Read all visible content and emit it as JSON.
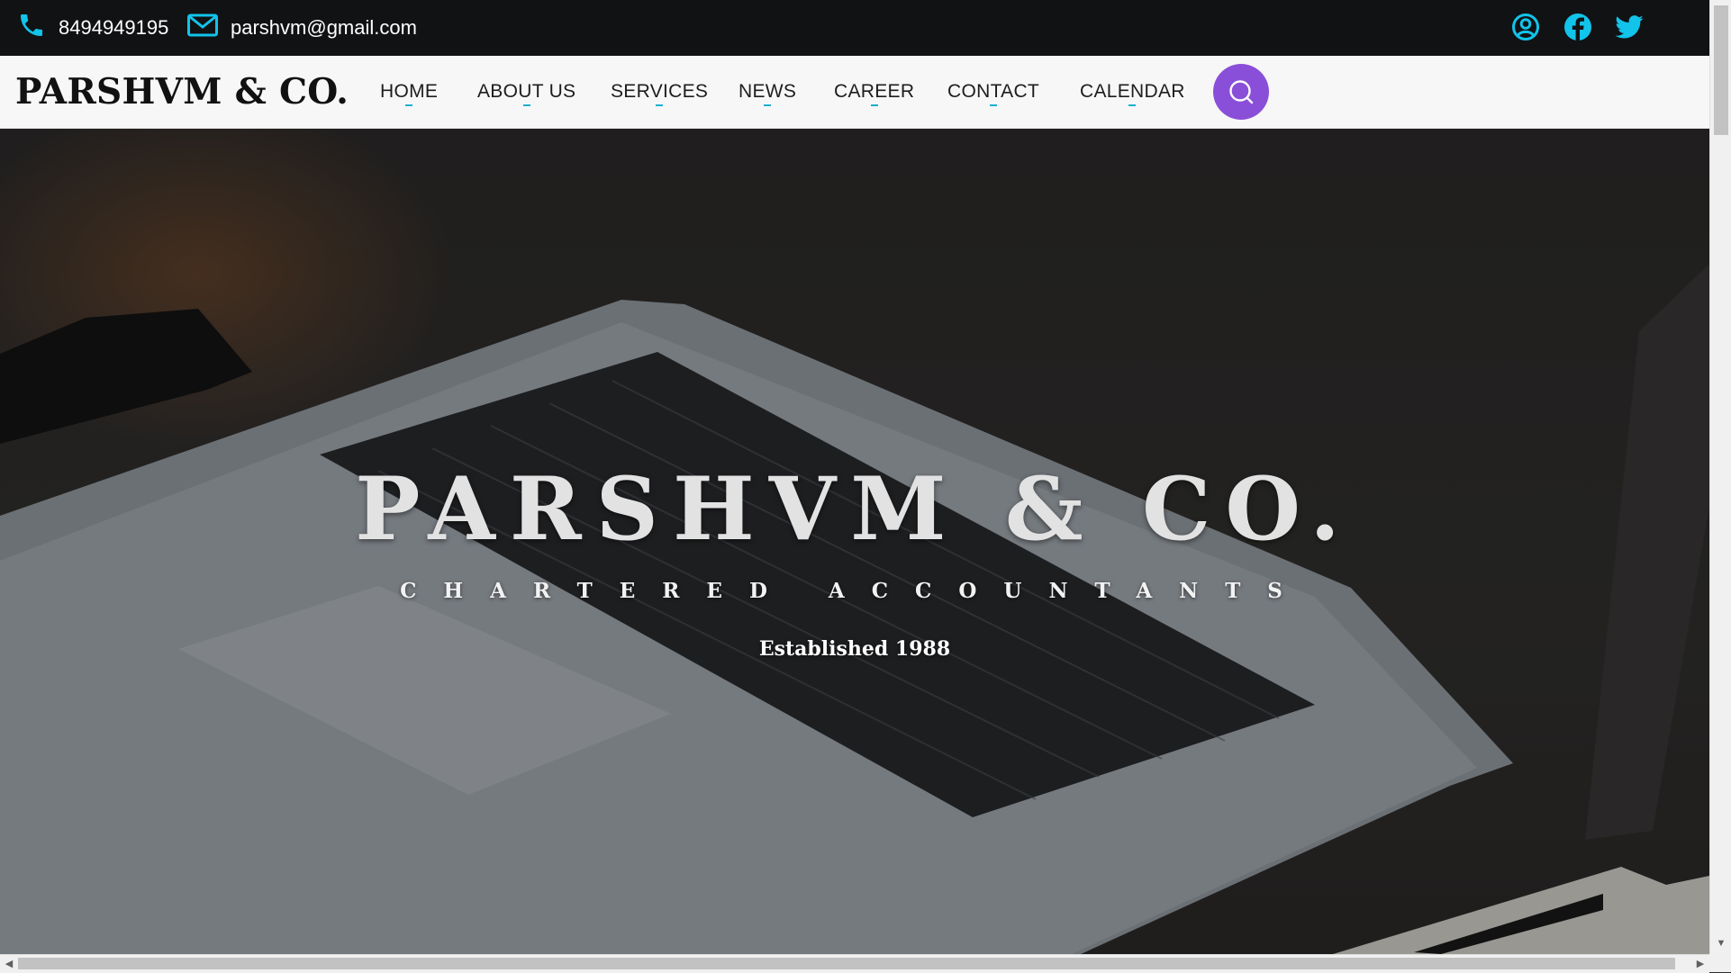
{
  "topbar": {
    "phone": "8494949195",
    "email": "parshvm@gmail.com",
    "social_icons": [
      "user-icon",
      "facebook-icon",
      "twitter-icon"
    ],
    "icon_color": "#12c3ea"
  },
  "navbar": {
    "logo": "PARSHVM & CO.",
    "items": [
      "HOME",
      "ABOUT US",
      "SERVICES",
      "NEWS",
      "CAREER",
      "CONTACT",
      "CALENDAR"
    ],
    "search_button_color": "#8a4fd8"
  },
  "hero": {
    "title": "PARSHVM & CO.",
    "subtitle": "CHARTERED ACCOUNTANTS",
    "established": "Established 1988"
  }
}
